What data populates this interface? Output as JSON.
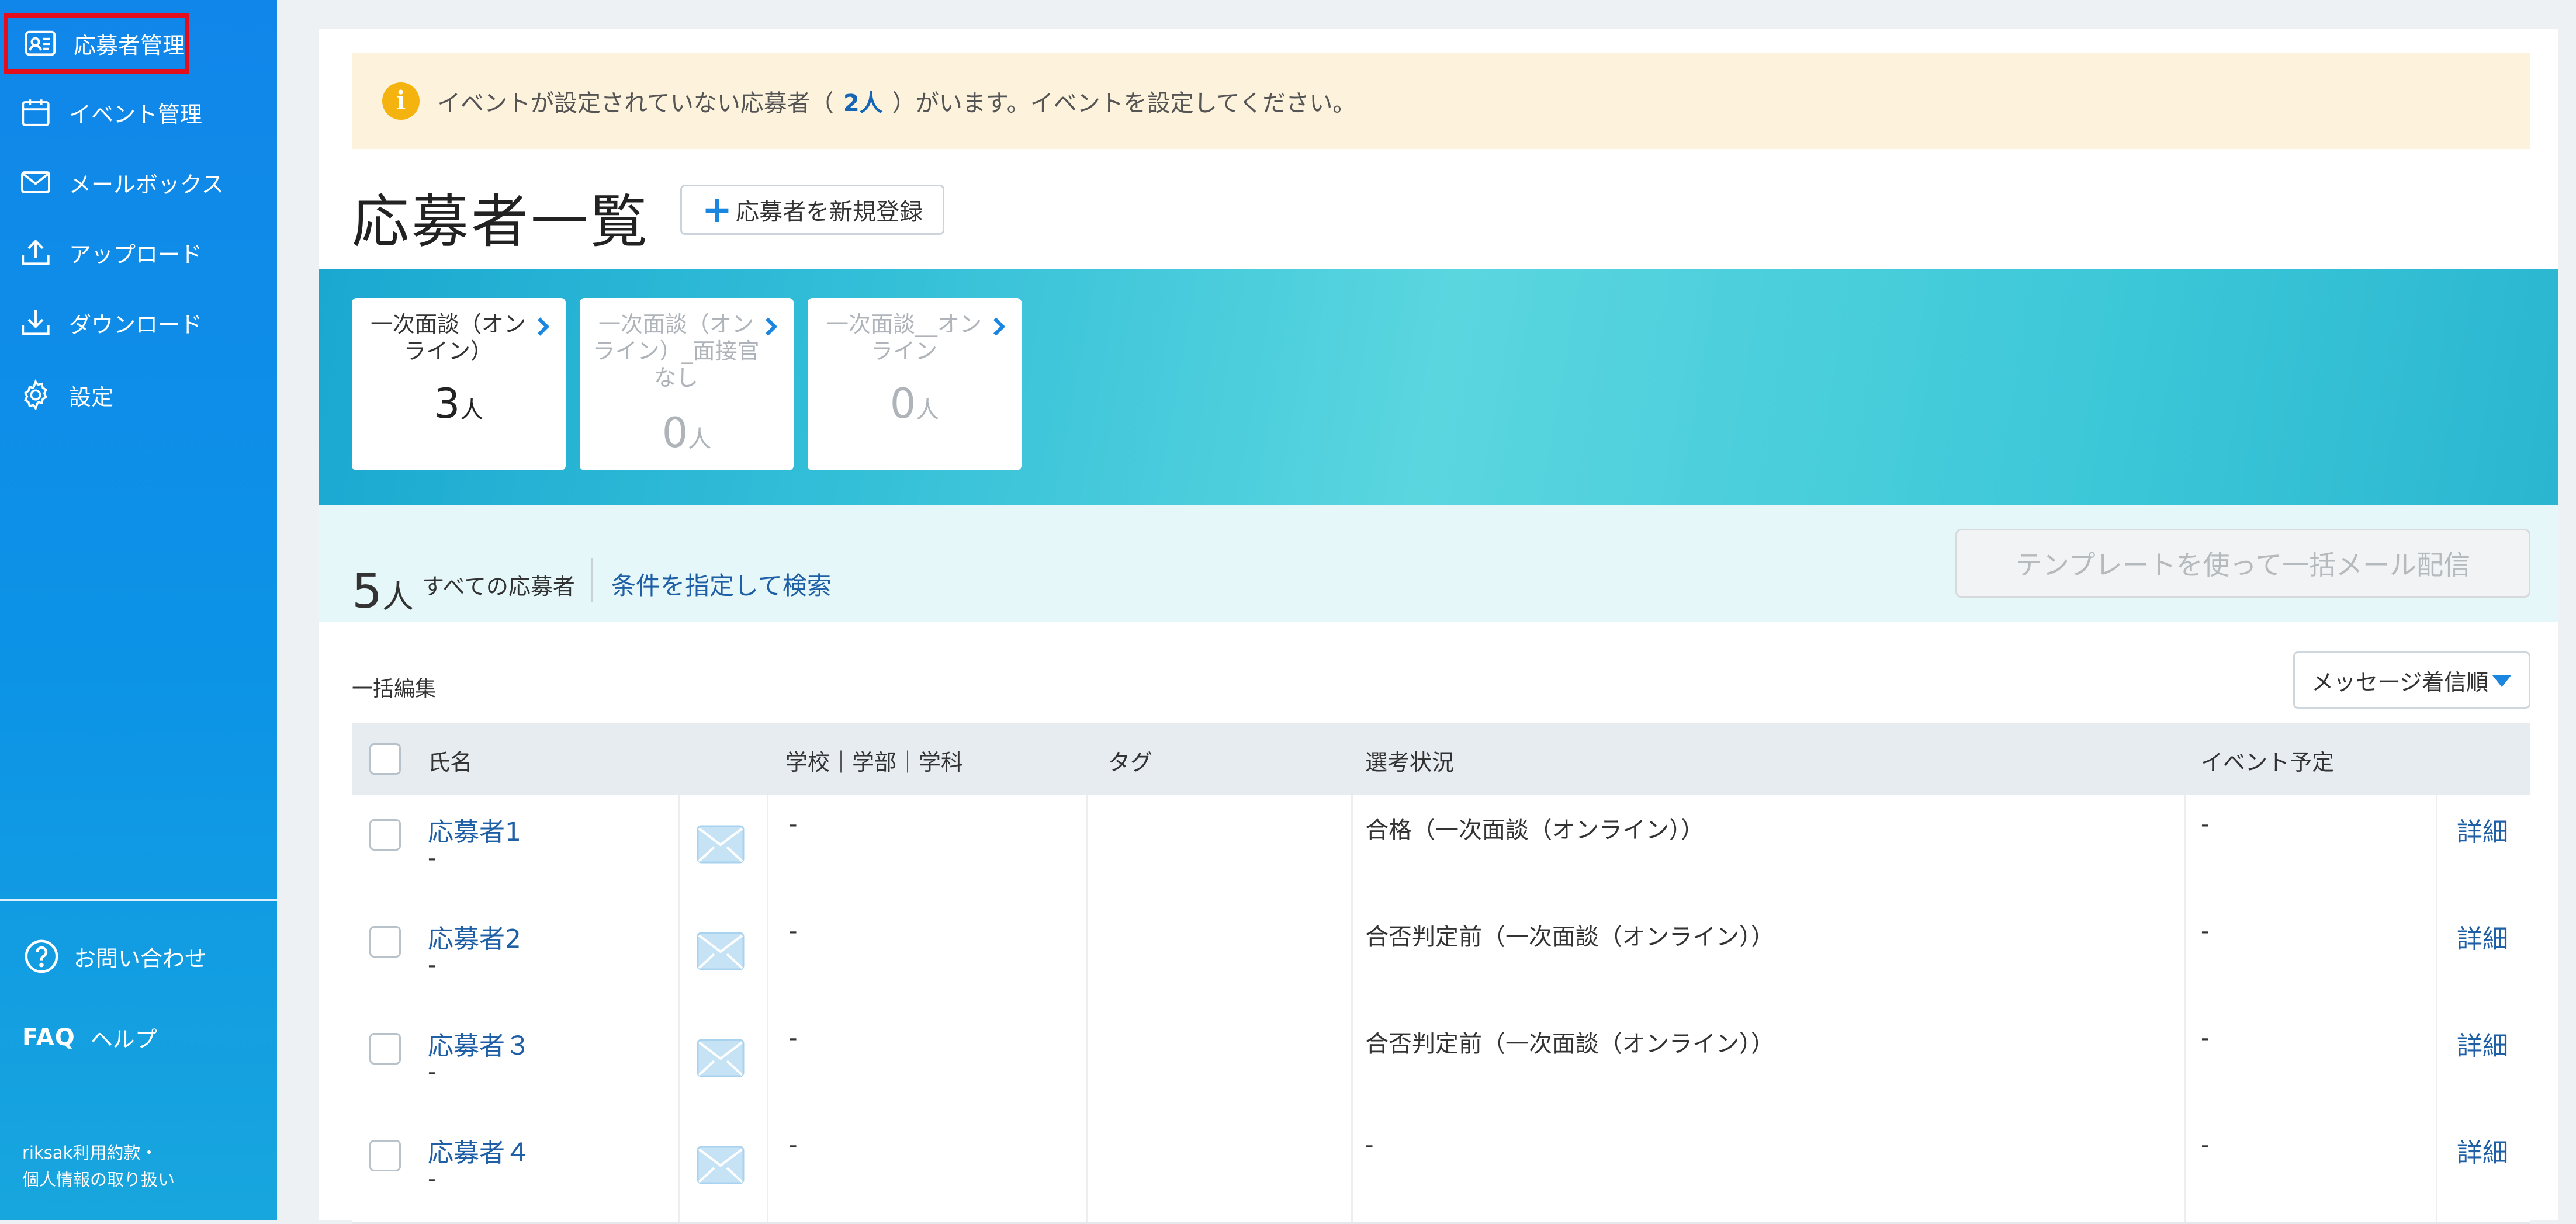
{
  "sidebar": {
    "items": [
      {
        "label": "応募者管理",
        "icon": "applicant-card-icon",
        "active": true
      },
      {
        "label": "イベント管理",
        "icon": "calendar-icon"
      },
      {
        "label": "メールボックス",
        "icon": "mail-icon"
      },
      {
        "label": "アップロード",
        "icon": "upload-icon"
      },
      {
        "label": "ダウンロード",
        "icon": "download-icon"
      },
      {
        "label": "設定",
        "icon": "gear-icon"
      }
    ],
    "contact_label": "お問い合わせ",
    "faq_badge": "FAQ",
    "help_label": "ヘルプ",
    "terms_line1": "riksak利用約款・",
    "terms_line2": "個人情報の取り扱い",
    "active_highlight_color": "#e30d1b"
  },
  "notice": {
    "prefix": "イベントが設定されていない応募者（",
    "count": "2人",
    "suffix": "）がいます。イベントを設定してください。"
  },
  "page_title": "応募者一覧",
  "add_button_label": "応募者を新規登録",
  "event_cards": [
    {
      "label": "一次面談（オンライン）",
      "count": "3",
      "unit": "人",
      "dim": false
    },
    {
      "label": "一次面談（オンライン）_面接官なし",
      "count": "0",
      "unit": "人",
      "dim": true
    },
    {
      "label": "一次面談__オンライン",
      "count": "0",
      "unit": "人",
      "dim": true
    }
  ],
  "summary": {
    "total_count": "5",
    "total_unit": "人",
    "total_label": "すべての応募者",
    "search_link": "条件を指定して検索",
    "bulk_mail_button": "テンプレートを使って一括メール配信"
  },
  "bulk_edit_label": "一括編集",
  "sort_selected": "メッセージ着信順",
  "table": {
    "headers": {
      "name": "氏名",
      "school": "学校｜学部｜学科",
      "tag": "タグ",
      "status": "選考状況",
      "event": "イベント予定"
    },
    "detail_label": "詳細",
    "rows": [
      {
        "name": "応募者1",
        "sub": "-",
        "school": "-",
        "tag": "",
        "status": "合格（一次面談（オンライン））",
        "event": "-"
      },
      {
        "name": "応募者2",
        "sub": "-",
        "school": "-",
        "tag": "",
        "status": "合否判定前（一次面談（オンライン））",
        "event": "-"
      },
      {
        "name": "応募者３",
        "sub": "-",
        "school": "-",
        "tag": "",
        "status": "合否判定前（一次面談（オンライン））",
        "event": "-"
      },
      {
        "name": "応募者４",
        "sub": "-",
        "school": "-",
        "tag": "",
        "status": "-",
        "event": "-"
      }
    ]
  }
}
